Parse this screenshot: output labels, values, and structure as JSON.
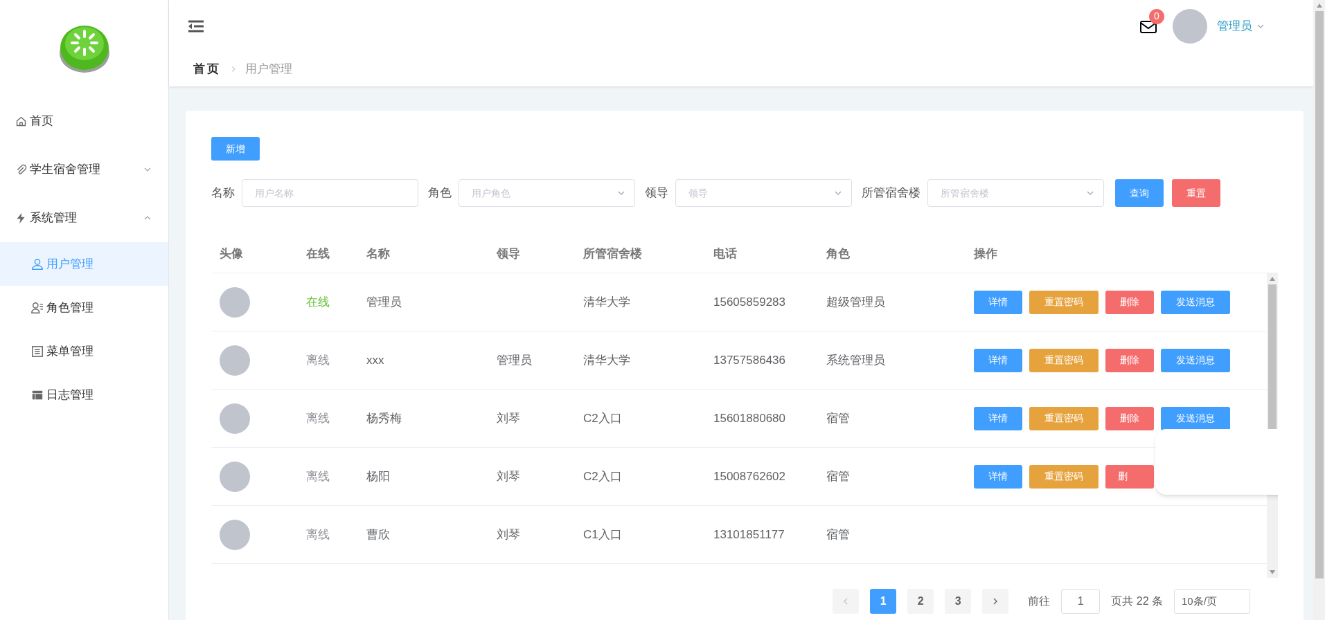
{
  "sidebar": {
    "items": [
      {
        "label": "首页",
        "kind": "link",
        "selected": false
      },
      {
        "label": "学生宿舍管理",
        "kind": "group",
        "expanded": false
      },
      {
        "label": "系统管理",
        "kind": "group",
        "expanded": true,
        "children": [
          {
            "label": "用户管理",
            "selected": true
          },
          {
            "label": "角色管理",
            "selected": false
          },
          {
            "label": "菜单管理",
            "selected": false
          },
          {
            "label": "日志管理",
            "selected": false
          }
        ]
      }
    ]
  },
  "header": {
    "badge": "0",
    "user": "管理员"
  },
  "breadcrumb": [
    "首页",
    "用户管理"
  ],
  "add_button": "新增",
  "filters": [
    {
      "label": "名称",
      "placeholder": "用户名称",
      "kind": "text"
    },
    {
      "label": "角色",
      "placeholder": "用户角色",
      "kind": "select"
    },
    {
      "label": "领导",
      "placeholder": "领导",
      "kind": "select"
    },
    {
      "label": "所管宿舍楼",
      "placeholder": "所管宿舍楼",
      "kind": "select"
    }
  ],
  "filter_buttons": [
    {
      "label": "查询",
      "kind": "primary"
    },
    {
      "label": "重置",
      "kind": "danger"
    }
  ],
  "table": {
    "columns": [
      "头像",
      "在线",
      "名称",
      "领导",
      "所管宿舍楼",
      "电话",
      "角色",
      "操作"
    ],
    "rows": [
      {
        "online": true,
        "status": "在线",
        "name": "管理员",
        "leader": "",
        "building": "清华大学",
        "phone": "15605859283",
        "role": "超级管理员",
        "actions": [
          {
            "label": "详情",
            "kind": "primary"
          },
          {
            "label": "重置密码",
            "kind": "warning"
          },
          {
            "label": "删除",
            "kind": "danger"
          },
          {
            "label": "发送消息",
            "kind": "primary"
          }
        ]
      },
      {
        "online": false,
        "status": "离线",
        "name": "xxx",
        "leader": "管理员",
        "building": "清华大学",
        "phone": "13757586436",
        "role": "系统管理员",
        "actions": [
          {
            "label": "详情",
            "kind": "primary"
          },
          {
            "label": "重置密码",
            "kind": "warning"
          },
          {
            "label": "删除",
            "kind": "danger"
          },
          {
            "label": "发送消息",
            "kind": "primary"
          }
        ]
      },
      {
        "online": false,
        "status": "离线",
        "name": "杨秀梅",
        "leader": "刘琴",
        "building": "C2入口",
        "phone": "15601880680",
        "role": "宿管",
        "actions": [
          {
            "label": "详情",
            "kind": "primary"
          },
          {
            "label": "重置密码",
            "kind": "warning"
          },
          {
            "label": "删除",
            "kind": "danger"
          },
          {
            "label": "发送消息",
            "kind": "primary"
          }
        ]
      },
      {
        "online": false,
        "status": "离线",
        "name": "杨阳",
        "leader": "刘琴",
        "building": "C2入口",
        "phone": "15008762602",
        "role": "宿管",
        "actions": [
          {
            "label": "详情",
            "kind": "primary"
          },
          {
            "label": "重置密码",
            "kind": "warning"
          },
          {
            "label": "删",
            "kind": "danger"
          }
        ]
      },
      {
        "online": false,
        "status": "离线",
        "name": "曹欣",
        "leader": "刘琴",
        "building": "C1入口",
        "phone": "13101851177",
        "role": "宿管",
        "actions": []
      }
    ]
  },
  "pagination": {
    "pages": [
      {
        "label": "1",
        "selected": true
      },
      {
        "label": "2",
        "selected": false
      },
      {
        "label": "3",
        "selected": false
      }
    ],
    "goto": "前往",
    "goto_value": "1",
    "total": "页共 22 条",
    "page_size": "10条/页"
  }
}
